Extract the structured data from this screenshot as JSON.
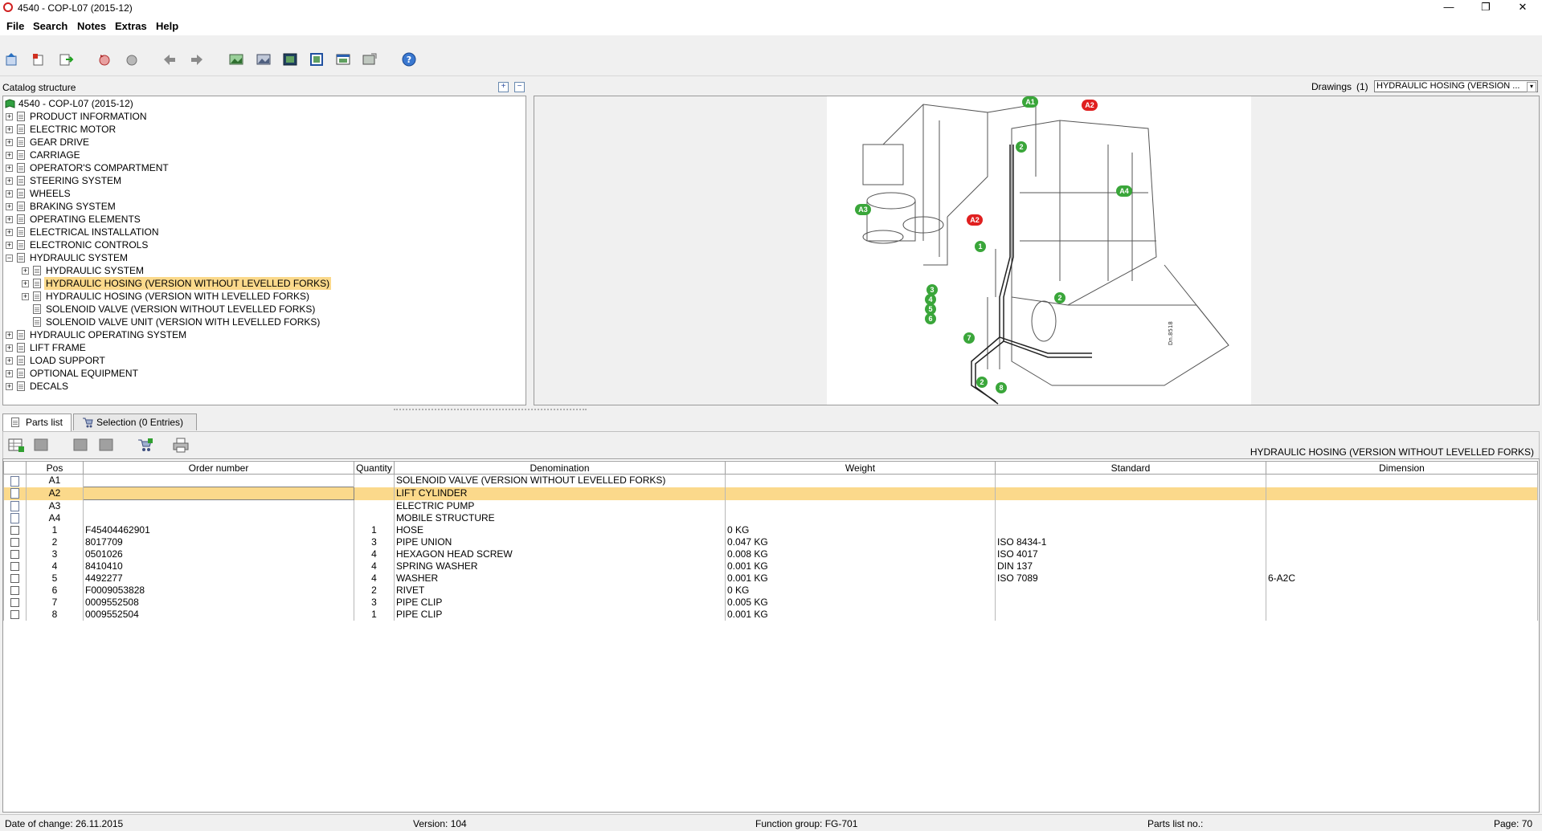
{
  "window": {
    "title": "4540 - COP-L07 (2015-12)",
    "minimize": "—",
    "maximize": "❐",
    "close": "✕"
  },
  "menu": [
    "File",
    "Search",
    "Notes",
    "Extras",
    "Help"
  ],
  "toolbar_icons": [
    "back-icon",
    "bookmark-icon",
    "export-icon",
    "refresh-icon",
    "history-icon",
    "arrow-left-icon",
    "arrow-right-icon",
    "image-icon",
    "zoom-image-icon",
    "fit-image-icon",
    "frame-icon",
    "window-icon",
    "print-image-icon",
    "help-icon"
  ],
  "catalog": {
    "label": "Catalog structure",
    "expand_all": "+",
    "collapse_all": "−",
    "root": "4540 - COP-L07 (2015-12)",
    "items": [
      {
        "label": "PRODUCT INFORMATION",
        "level": 1,
        "exp": "+"
      },
      {
        "label": "ELECTRIC MOTOR",
        "level": 1,
        "exp": "+"
      },
      {
        "label": "GEAR DRIVE",
        "level": 1,
        "exp": "+"
      },
      {
        "label": "CARRIAGE",
        "level": 1,
        "exp": "+"
      },
      {
        "label": "OPERATOR'S COMPARTMENT",
        "level": 1,
        "exp": "+"
      },
      {
        "label": "STEERING SYSTEM",
        "level": 1,
        "exp": "+"
      },
      {
        "label": "WHEELS",
        "level": 1,
        "exp": "+"
      },
      {
        "label": "BRAKING SYSTEM",
        "level": 1,
        "exp": "+"
      },
      {
        "label": "OPERATING ELEMENTS",
        "level": 1,
        "exp": "+"
      },
      {
        "label": "ELECTRICAL INSTALLATION",
        "level": 1,
        "exp": "+"
      },
      {
        "label": "ELECTRONIC CONTROLS",
        "level": 1,
        "exp": "+"
      },
      {
        "label": "HYDRAULIC SYSTEM",
        "level": 1,
        "exp": "−"
      },
      {
        "label": "HYDRAULIC SYSTEM",
        "level": 2,
        "exp": "+"
      },
      {
        "label": "HYDRAULIC HOSING (VERSION WITHOUT LEVELLED FORKS)",
        "level": 2,
        "exp": "+",
        "selected": true
      },
      {
        "label": "HYDRAULIC HOSING (VERSION WITH LEVELLED FORKS)",
        "level": 2,
        "exp": "+"
      },
      {
        "label": "SOLENOID VALVE (VERSION WITHOUT LEVELLED FORKS)",
        "level": 2,
        "exp": ""
      },
      {
        "label": "SOLENOID VALVE UNIT (VERSION WITH LEVELLED FORKS)",
        "level": 2,
        "exp": ""
      },
      {
        "label": "HYDRAULIC OPERATING SYSTEM",
        "level": 1,
        "exp": "+"
      },
      {
        "label": "LIFT FRAME",
        "level": 1,
        "exp": "+"
      },
      {
        "label": "LOAD SUPPORT",
        "level": 1,
        "exp": "+"
      },
      {
        "label": "OPTIONAL EQUIPMENT",
        "level": 1,
        "exp": "+"
      },
      {
        "label": "DECALS",
        "level": 1,
        "exp": "+"
      }
    ]
  },
  "drawings": {
    "label": "Drawings",
    "count": "(1)",
    "selected": "HYDRAULIC HOSING (VERSION ..."
  },
  "drawing_callouts": [
    "A1",
    "A2",
    "A3",
    "A4",
    "A2",
    "1",
    "2",
    "2",
    "2",
    "3",
    "4",
    "5",
    "6",
    "7",
    "8"
  ],
  "tabs": {
    "parts": "Parts list",
    "selection": "Selection (0 Entries)"
  },
  "parts_list": {
    "title": "HYDRAULIC HOSING (VERSION WITHOUT LEVELLED FORKS)",
    "columns": [
      "Pos",
      "Order number",
      "Quantity",
      "Denomination",
      "Weight",
      "Standard",
      "Dimension"
    ],
    "rows": [
      {
        "type": "doc",
        "pos": "A1",
        "order": "",
        "qty": "",
        "name": "SOLENOID VALVE (VERSION WITHOUT LEVELLED FORKS)",
        "weight": "",
        "standard": "",
        "dim": ""
      },
      {
        "type": "doc",
        "pos": "A2",
        "order": "",
        "qty": "",
        "name": "LIFT CYLINDER",
        "weight": "",
        "standard": "",
        "dim": "",
        "selected": true
      },
      {
        "type": "doc",
        "pos": "A3",
        "order": "",
        "qty": "",
        "name": "ELECTRIC PUMP",
        "weight": "",
        "standard": "",
        "dim": ""
      },
      {
        "type": "doc",
        "pos": "A4",
        "order": "",
        "qty": "",
        "name": "MOBILE STRUCTURE",
        "weight": "",
        "standard": "",
        "dim": ""
      },
      {
        "type": "chk",
        "pos": "1",
        "order": "F45404462901",
        "qty": "1",
        "name": "HOSE",
        "weight": "0 KG",
        "standard": "",
        "dim": ""
      },
      {
        "type": "chk",
        "pos": "2",
        "order": "8017709",
        "qty": "3",
        "name": "PIPE UNION",
        "weight": "0.047 KG",
        "standard": "ISO 8434-1",
        "dim": ""
      },
      {
        "type": "chk",
        "pos": "3",
        "order": "0501026",
        "qty": "4",
        "name": "HEXAGON HEAD SCREW",
        "weight": "0.008 KG",
        "standard": "ISO 4017",
        "dim": ""
      },
      {
        "type": "chk",
        "pos": "4",
        "order": "8410410",
        "qty": "4",
        "name": "SPRING WASHER",
        "weight": "0.001 KG",
        "standard": "DIN 137",
        "dim": ""
      },
      {
        "type": "chk",
        "pos": "5",
        "order": "4492277",
        "qty": "4",
        "name": "WASHER",
        "weight": "0.001 KG",
        "standard": "ISO 7089",
        "dim": "6-A2C"
      },
      {
        "type": "chk",
        "pos": "6",
        "order": "F0009053828",
        "qty": "2",
        "name": "RIVET",
        "weight": "0 KG",
        "standard": "",
        "dim": ""
      },
      {
        "type": "chk",
        "pos": "7",
        "order": "0009552508",
        "qty": "3",
        "name": "PIPE CLIP",
        "weight": "0.005 KG",
        "standard": "",
        "dim": ""
      },
      {
        "type": "chk",
        "pos": "8",
        "order": "0009552504",
        "qty": "1",
        "name": "PIPE CLIP",
        "weight": "0.001 KG",
        "standard": "",
        "dim": ""
      }
    ]
  },
  "status": {
    "date": "Date of change: 26.11.2015",
    "version": "Version: 104",
    "function_group": "Function group: FG-701",
    "parts_list_no": "Parts list no.:",
    "page": "Page: 70"
  }
}
